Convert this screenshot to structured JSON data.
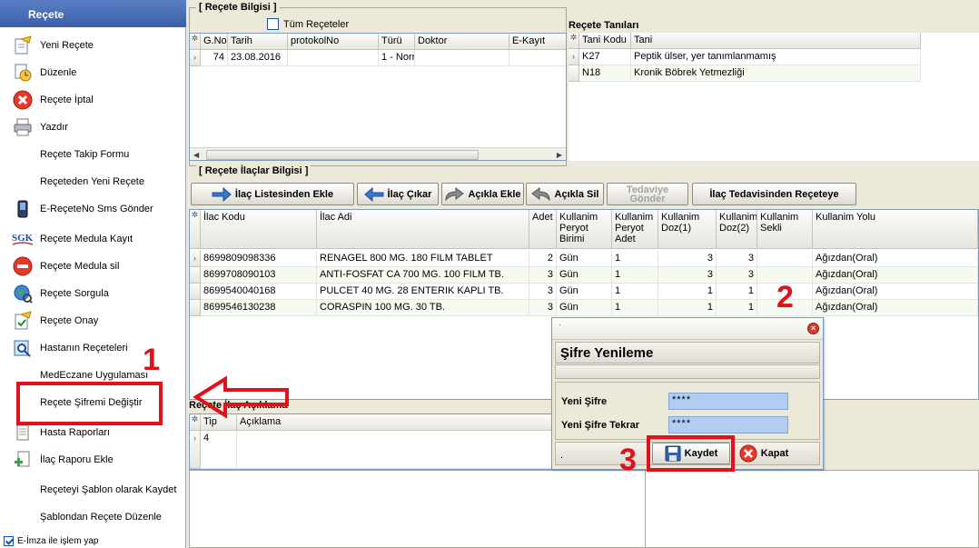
{
  "sidebar": {
    "title": "Reçete",
    "items": [
      {
        "label": "Yeni Reçete",
        "icon": "new-prescription-icon"
      },
      {
        "label": "Düzenle",
        "icon": "edit-clock-icon"
      },
      {
        "label": "Reçete İptal",
        "icon": "cancel-icon"
      },
      {
        "label": "Yazdır",
        "icon": "printer-icon"
      },
      {
        "label": "Reçete Takip Formu",
        "icon": ""
      },
      {
        "label": "Reçeteden Yeni Reçete",
        "icon": ""
      },
      {
        "label": "E-ReçeteNo Sms Gönder",
        "icon": "phone-icon"
      },
      {
        "label": "Reçete Medula Kayıt",
        "icon": "sgk-icon"
      },
      {
        "label": "Reçete Medula sil",
        "icon": "stop-icon"
      },
      {
        "label": "Reçete Sorgula",
        "icon": "globe-icon"
      },
      {
        "label": "Reçete Onay",
        "icon": "approve-icon"
      },
      {
        "label": "Hastanın Reçeteleri",
        "icon": "search-doc-icon"
      },
      {
        "label": "MedEczane Uygulaması",
        "icon": ""
      },
      {
        "label": "Reçete Şifremi Değiştir",
        "icon": ""
      },
      {
        "label": "Hasta Raporları",
        "icon": "report-icon"
      },
      {
        "label": "İlaç Raporu Ekle",
        "icon": "add-report-icon"
      },
      {
        "label": "Reçeteyi Şablon olarak Kaydet",
        "icon": ""
      },
      {
        "label": "Şablondan Reçete Düzenle",
        "icon": ""
      }
    ],
    "footer_label": "E-İmza ile işlem yap"
  },
  "recete_bilgisi": {
    "title": "[ Reçete Bilgisi ]",
    "tum_receteler_label": "Tüm Reçeteler",
    "columns": [
      "G.No",
      "Tarih",
      "protokolNo",
      "Türü",
      "Doktor",
      "E-Kayıt"
    ],
    "rows": [
      {
        "gno": "74",
        "tarih": "23.08.2016",
        "protokol": "",
        "turu": "1 - Norr",
        "doktor": "",
        "ekayit": ""
      }
    ]
  },
  "recete_tanilari": {
    "title": "Reçete Tanıları",
    "columns": [
      "Tani Kodu",
      "Tani"
    ],
    "rows": [
      {
        "kod": "K27",
        "tani": "Peptik ülser, yer tanımlanmamış"
      },
      {
        "kod": "N18",
        "tani": "Kronik Böbrek Yetmezliği"
      }
    ]
  },
  "ilaclar": {
    "title": "[ Reçete İlaçlar Bilgisi ]",
    "buttons": {
      "ilac_listesi": "İlaç Listesinden Ekle",
      "ilac_cikar": "İlaç Çıkar",
      "aciklama_ekle": "Açıkla Ekle",
      "aciklama_sil": "Açıkla Sil",
      "tedaviye_line1": "Tedaviye",
      "tedaviye_line2": "Gönder",
      "tedavisinden": "İlaç Tedavisinden Reçeteye"
    },
    "columns": [
      "İlac Kodu",
      "İlac Adi",
      "Adet",
      "Kullanim Peryot Birimi",
      "Kullanim Peryot Adet",
      "Kullanim Doz(1)",
      "Kullanim Doz(2)",
      "Kullanim Sekli",
      "Kullanim Yolu"
    ],
    "rows": [
      {
        "kod": "8699809098336",
        "adi": "RENAGEL 800 MG. 180 FILM TABLET",
        "adet": "2",
        "birim": "Gün",
        "padet": "1",
        "doz1": "3",
        "doz2": "3",
        "sekli": "",
        "yolu": "Ağızdan(Oral)"
      },
      {
        "kod": "8699708090103",
        "adi": "ANTI-FOSFAT CA 700 MG. 100 FILM TB.",
        "adet": "3",
        "birim": "Gün",
        "padet": "1",
        "doz1": "3",
        "doz2": "3",
        "sekli": "",
        "yolu": "Ağızdan(Oral)"
      },
      {
        "kod": "8699540040168",
        "adi": "PULCET 40 MG. 28 ENTERIK KAPLI TB.",
        "adet": "3",
        "birim": "Gün",
        "padet": "1",
        "doz1": "1",
        "doz2": "1",
        "sekli": "",
        "yolu": "Ağızdan(Oral)"
      },
      {
        "kod": "8699546130238",
        "adi": "CORASPIN 100 MG. 30 TB.",
        "adet": "3",
        "birim": "Gün",
        "padet": "1",
        "doz1": "1",
        "doz2": "1",
        "sekli": "",
        "yolu": "Ağızdan(Oral)"
      }
    ]
  },
  "aciklama": {
    "title": "Reçete İlaç Açıklama",
    "columns": [
      "Tip",
      "Açıklama"
    ],
    "rows": [
      {
        "tip": "4",
        "aciklama": ""
      }
    ]
  },
  "dialog": {
    "title": "Şifre Yenileme",
    "yeni_sifre_label": "Yeni Şifre",
    "yeni_sifre_value": "****",
    "tekrar_label": "Yeni Şifre Tekrar",
    "tekrar_value": "****",
    "status": ".",
    "kaydet": "Kaydet",
    "kapat": "Kapat"
  },
  "annotations": [
    "1",
    "2",
    "3"
  ],
  "colors": {
    "annotation": "#e3101a",
    "header_blue": "#3a5ea8",
    "input_blue": "#b2cdf2"
  }
}
